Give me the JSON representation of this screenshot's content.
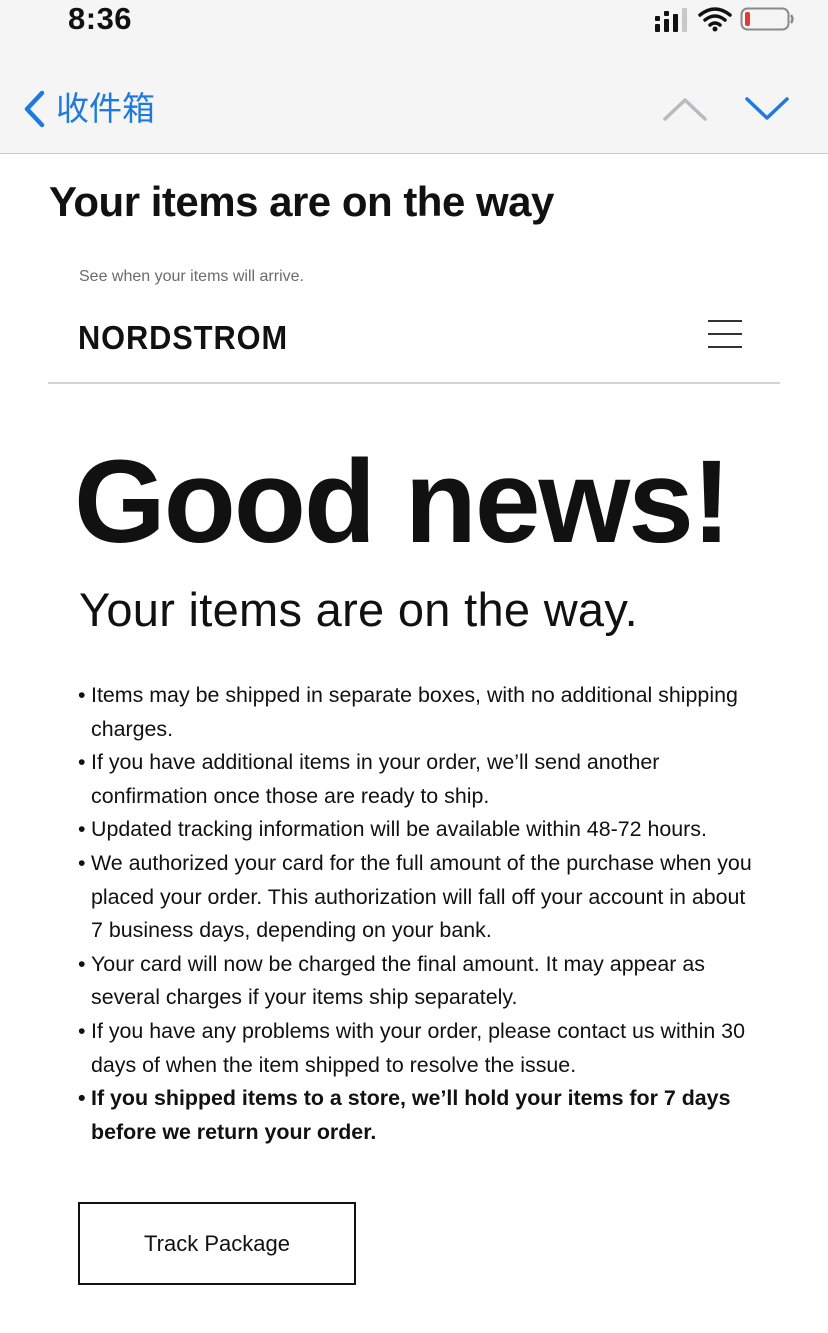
{
  "status_bar": {
    "time": "8:36"
  },
  "nav": {
    "back_label": "收件箱",
    "prev_icon": "chevron-up-icon",
    "next_icon": "chevron-down-icon",
    "accent_color": "#1f7ae0"
  },
  "email": {
    "subject": "Your items are on the way",
    "preheader": "See when your items will arrive.",
    "brand": "NORDSTROM",
    "menu_icon": "hamburger-menu-icon",
    "hero_title": "Good news!",
    "hero_subtitle": "Your items are on the way.",
    "bullets": [
      "Items may be shipped in separate boxes, with no additional shipping charges.",
      "If you have additional items in your order, we’ll send another confirmation once those are ready to ship.",
      "Updated tracking information will be available within 48-72 hours.",
      "We authorized your card for the full amount of the purchase when you placed your order. This authorization will fall off your account in about 7 business days, depending on your bank.",
      "Your card will now be charged the final amount. It may appear as several charges if your items ship separately.",
      "If you have any problems with your order, please contact us within 30 days of when the item shipped to resolve the issue.",
      "If you shipped items to a store, we’ll hold your items for 7 days before we return your order."
    ],
    "track_button": "Track Package"
  }
}
